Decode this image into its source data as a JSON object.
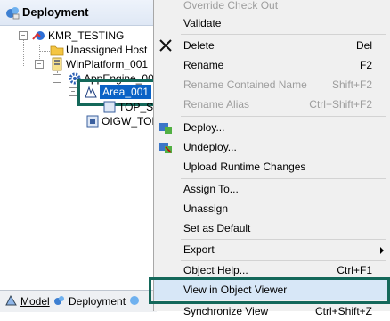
{
  "panel": {
    "title": "Deployment",
    "tree": {
      "galaxy": "KMR_TESTING",
      "unassigned": "Unassigned Host",
      "platform": "WinPlatform_001",
      "engine": "AppEngine_00",
      "area": "Area_001",
      "top_se": "TOP_Se",
      "oigw": "OIGW_TOP"
    }
  },
  "tabs": {
    "model": "Model",
    "deployment": "Deployment"
  },
  "menu": {
    "items": [
      {
        "label": "Override Check Out",
        "shortcut": "",
        "disabled": true
      },
      {
        "label": "Validate",
        "shortcut": "",
        "disabled": false
      },
      {
        "label": "Delete",
        "shortcut": "Del",
        "disabled": false
      },
      {
        "label": "Rename",
        "shortcut": "F2",
        "disabled": false
      },
      {
        "label": "Rename Contained Name",
        "shortcut": "Shift+F2",
        "disabled": true
      },
      {
        "label": "Rename Alias",
        "shortcut": "Ctrl+Shift+F2",
        "disabled": true
      },
      {
        "label": "Deploy...",
        "shortcut": "",
        "disabled": false
      },
      {
        "label": "Undeploy...",
        "shortcut": "",
        "disabled": false
      },
      {
        "label": "Upload Runtime Changes",
        "shortcut": "",
        "disabled": false
      },
      {
        "label": "Assign To...",
        "shortcut": "",
        "disabled": false
      },
      {
        "label": "Unassign",
        "shortcut": "",
        "disabled": false
      },
      {
        "label": "Set as Default",
        "shortcut": "",
        "disabled": false
      },
      {
        "label": "Export",
        "shortcut": "",
        "disabled": false
      },
      {
        "label": "Object Help...",
        "shortcut": "Ctrl+F1",
        "disabled": false
      },
      {
        "label": "View in Object Viewer",
        "shortcut": "",
        "disabled": false
      },
      {
        "label": "Synchronize View",
        "shortcut": "Ctrl+Shift+Z",
        "disabled": false
      }
    ]
  },
  "colors": {
    "highlight_box": "#14685a",
    "selection": "#0a62c6",
    "menu_bg": "#f0f0f0"
  }
}
